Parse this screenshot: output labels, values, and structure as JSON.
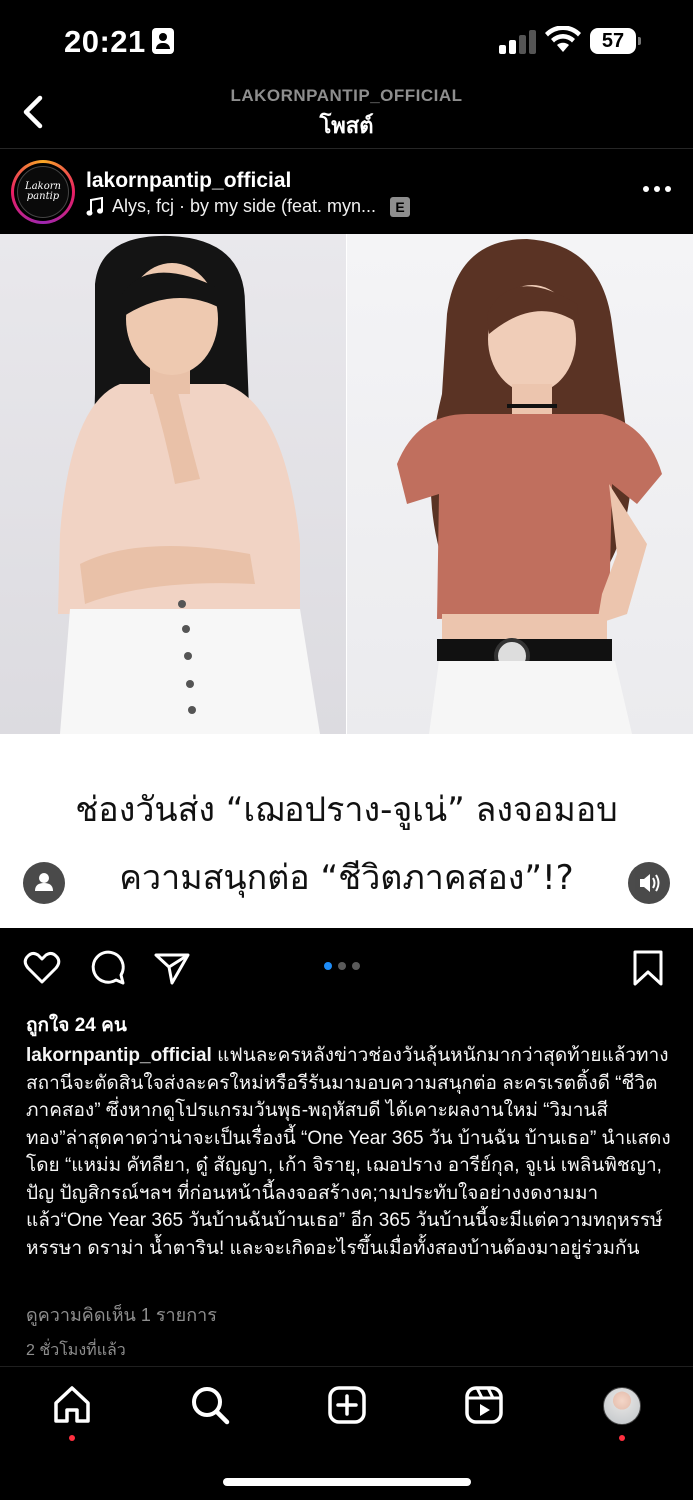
{
  "status_bar": {
    "time": "20:21",
    "battery": "57"
  },
  "header": {
    "account": "LAKORNPANTIP_OFFICIAL",
    "title": "โพสต์"
  },
  "post": {
    "username": "lakornpantip_official",
    "avatar_text": "Lakorn pantip",
    "music": "Alys, fcj · by my side (feat. myn...",
    "explicit_badge": "E",
    "headline_line1": "ช่องวันส่ง “เฌอปราง-จูเน่” ลงจอมอบ",
    "headline_line2": "ความสนุกต่อ “ชีวิตภาคสอง”!?",
    "likes": "ถูกใจ 24 คน",
    "caption_text": " แฟนละครหลังข่าวช่องวันลุ้นหนักมากว่าสุดท้ายแล้วทางสถานีจะตัดสินใจส่งละครใหม่หรือรีรันมามอบความสนุกต่อ ละครเรตติ้งดี “ชีวิตภาคสอง” ซึ่งหากดูโปรแกรมวันพุธ-พฤหัสบดี ได้เคาะผลงานใหม่ “วิมานสีทอง”ล่าสุดคาดว่าน่าจะเป็นเรื่องนี้ “One Year 365 วัน บ้านฉัน บ้านเธอ” นำแสดงโดย “แหม่ม คัทลียา, ดู๋ สัญญา, เก้า จิรายุ, เฌอปราง อารีย์กุล, จูเน่ เพลินพิชญา, ปัญ ปัญสิกรณ์ฯลฯ ที่ก่อนหน้านี้ลงจอสร้างค;ามประทับใจอย่างงดงามมาแล้ว“One Year 365 วันบ้านฉันบ้านเธอ” อีก 365 วันบ้านนี้จะมีแต่ความทฤหรรษ์ หรรษา ดราม่า น้ำตาริน! และจะเกิดอะไรขึ้นเมื่อทั้งสองบ้านต้องมาอยู่ร่วมกัน",
    "comments_link": "ดูความคิดเห็น 1 รายการ",
    "time_ago": "2 ชั่วโมงที่แล้ว",
    "carousel": {
      "count": 3,
      "active": 1
    }
  },
  "icons": {
    "back": "chevron-left-icon",
    "more": "more-horizontal-icon",
    "music": "music-note-icon",
    "like": "heart-icon",
    "comment": "comment-icon",
    "share": "send-icon",
    "save": "bookmark-icon",
    "tag": "user-tag-icon",
    "sound": "speaker-icon",
    "home": "home-icon",
    "search": "search-icon",
    "create": "add-post-icon",
    "reels": "reels-icon"
  },
  "colors": {
    "background": "#000000",
    "muted": "#8e8e8e",
    "accent_dot": "#1d8cf8",
    "notification": "#ff3040"
  }
}
